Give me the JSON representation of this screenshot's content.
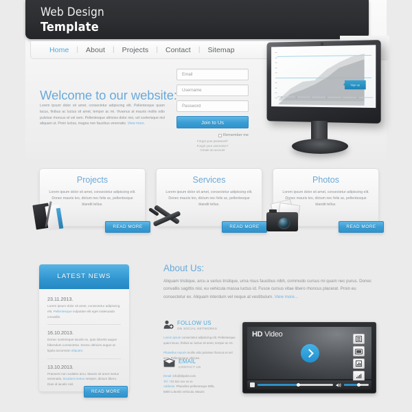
{
  "header": {
    "title_line1": "Web Design",
    "title_line2": "Template"
  },
  "nav": {
    "items": [
      {
        "label": "Home",
        "active": true
      },
      {
        "label": "About",
        "active": false
      },
      {
        "label": "Projects",
        "active": false
      },
      {
        "label": "Contact",
        "active": false
      },
      {
        "label": "Sitemap",
        "active": false
      }
    ],
    "separator": "|"
  },
  "welcome": {
    "heading": "Welcome to our website:",
    "body": "Lorem ipsum dolor sit amet, consectetur adipiscing elit. Pellentesque quam lacus, finibus ac luctus sit amet, tempor ac mi. Vivamus at mauris mollis odio pulvinar rhoncus et vel sem. Pellentesque ultricies dolor nisi, vel scelerisque nisl aliquam ut. Proin luctus, magna non faucibus venenatis.",
    "more_link": "View more."
  },
  "signup_form": {
    "email_placeholder": "Email",
    "username_placeholder": "Username",
    "password_placeholder": "Password",
    "submit_label": "Join to Us",
    "remember_label": "Remember me",
    "links": [
      "Forgot your password?",
      "Forgot your username?",
      "Create an account"
    ]
  },
  "monitor": {
    "tooltip_label": "Sign up"
  },
  "cards": [
    {
      "title": "Projects",
      "body": "Lorem ipsum dolor sit amet, consectetur adipiscing elit. Donec mauris leo, dictum nec felis ac, pellentesque blandit tellus.",
      "button": "READ MORE",
      "icon": "notebook-pen-icon"
    },
    {
      "title": "Services",
      "body": "Lorem ipsum dolor sit amet, consectetur adipiscing elit. Donec mauris leo, dictum nec felis ac, pellentesque blandit tellus.",
      "button": "READ MORE",
      "icon": "tools-icon"
    },
    {
      "title": "Photos",
      "body": "Lorem ipsum dolor sit amet, consectetur adipiscing elit. Donec mauris leo, dictum nec felis ac, pellentesque blandit tellus.",
      "button": "READ MORE",
      "icon": "camera-icon"
    }
  ],
  "news": {
    "title": "LATEST NEWS",
    "button": "READ MORE",
    "items": [
      {
        "date": "23.11.2013.",
        "text_before": "Lorem ipsum dolor sit amet, consectetur adipiscing elit. ",
        "link": "Pellentesque",
        "text_after": " vulputate elit eget malesuada convallis."
      },
      {
        "date": "16.10.2013.",
        "text_before": "Donec scelerisque iaculis ex, quis lobortis augue bibendum consectetur. Donec ultricies augue at ligula accumsan ",
        "link": "aliquam",
        "text_after": "."
      },
      {
        "date": "13.10.2013.",
        "text_before": "Praesent non sodales arcu. Mauris sit amet metus venenatis, ",
        "link": "tincidunt metus",
        "text_after": " semper, dictum libero. Duis id iaculis nisl."
      }
    ]
  },
  "about": {
    "heading": "About Us:",
    "body": "Aliquam tristique, arcu a varius tristique, urna risus faucibus nibh, commodo cursus mi quam nec purus. Donec convallis sagittis nisl, eu vehicula massa luctus id. Fusce cursus vitae libero rhoncus placerat. Proin eu consectetur ex. Aliquam interdum vel neque at vestibulum. ",
    "more_link": "View more..."
  },
  "follow": {
    "title": "FOLLOW US",
    "subtitle": "ON SOCIAL NETWORKS",
    "paragraph1_link": "Lorem ipsum",
    "paragraph1": " consectetur adipiscing elit. Pellentesque quam lacus, finibus ac luctus sit amet, tempor ac mi.",
    "paragraph2_link": "Phasellus mauris",
    "paragraph2": " mollis odio pulvinar rhoncus et vel sem. Pellentesque ultricies."
  },
  "email_block": {
    "title": "EMAIL",
    "subtitle": "CONTACT US",
    "rows": [
      {
        "label": "Email:",
        "value": "info@slipdot.com"
      },
      {
        "label": "Tel:",
        "value": "+31 0xx xxx xx xx"
      },
      {
        "label": "Address:",
        "value": "Phasellus pellentesque 88fa,"
      },
      {
        "label": "",
        "value": "6800 Lobortis vehicula, Mauris"
      }
    ]
  },
  "video": {
    "brand_bold": "HD",
    "brand_light": "Video",
    "side_buttons": [
      "list-icon",
      "screen-icon",
      "chart-bars-icon",
      "equalizer-icon"
    ],
    "play_button": "play-icon",
    "progress_percent": 54,
    "volume_percent": 60
  },
  "colors": {
    "accent": "#3d9ed4",
    "heading": "#6aa9d8",
    "header_dark": "#2c2d30",
    "background": "#ebebeb"
  }
}
